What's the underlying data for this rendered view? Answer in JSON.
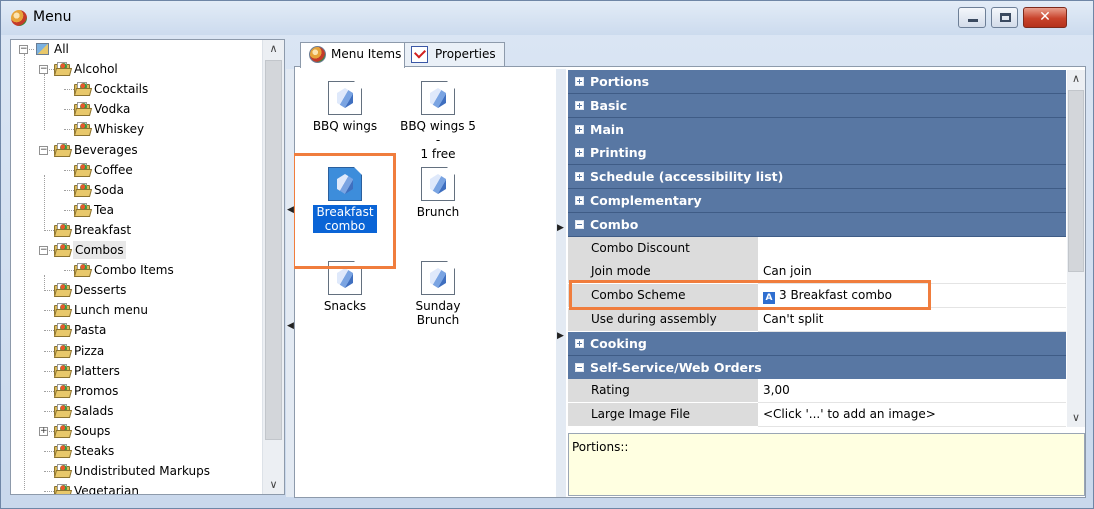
{
  "window": {
    "title": "Menu"
  },
  "tree": {
    "items": [
      {
        "label": "All",
        "level": 0,
        "expander": "minus",
        "icon": "all-icon"
      },
      {
        "label": "Alcohol",
        "level": 1,
        "expander": "minus",
        "icon": "folder-icon"
      },
      {
        "label": "Cocktails",
        "level": 2,
        "expander": "",
        "icon": "folder-icon"
      },
      {
        "label": "Vodka",
        "level": 2,
        "expander": "",
        "icon": "folder-icon"
      },
      {
        "label": "Whiskey",
        "level": 2,
        "expander": "",
        "icon": "folder-icon"
      },
      {
        "label": "Beverages",
        "level": 1,
        "expander": "minus",
        "icon": "folder-icon"
      },
      {
        "label": "Coffee",
        "level": 2,
        "expander": "",
        "icon": "folder-icon"
      },
      {
        "label": "Soda",
        "level": 2,
        "expander": "",
        "icon": "folder-icon"
      },
      {
        "label": "Tea",
        "level": 2,
        "expander": "",
        "icon": "folder-icon"
      },
      {
        "label": "Breakfast",
        "level": 1,
        "expander": "",
        "icon": "folder-icon"
      },
      {
        "label": "Combos",
        "level": 1,
        "expander": "minus",
        "icon": "folder-icon",
        "selected": true
      },
      {
        "label": "Combo Items",
        "level": 2,
        "expander": "",
        "icon": "folder-icon"
      },
      {
        "label": "Desserts",
        "level": 1,
        "expander": "",
        "icon": "folder-icon"
      },
      {
        "label": "Lunch menu",
        "level": 1,
        "expander": "",
        "icon": "folder-icon"
      },
      {
        "label": "Pasta",
        "level": 1,
        "expander": "",
        "icon": "folder-icon"
      },
      {
        "label": "Pizza",
        "level": 1,
        "expander": "",
        "icon": "folder-icon"
      },
      {
        "label": "Platters",
        "level": 1,
        "expander": "",
        "icon": "folder-icon"
      },
      {
        "label": "Promos",
        "level": 1,
        "expander": "",
        "icon": "folder-icon"
      },
      {
        "label": "Salads",
        "level": 1,
        "expander": "",
        "icon": "folder-icon"
      },
      {
        "label": "Soups",
        "level": 1,
        "expander": "plus",
        "icon": "folder-icon"
      },
      {
        "label": "Steaks",
        "level": 1,
        "expander": "",
        "icon": "folder-icon"
      },
      {
        "label": "Undistributed Markups",
        "level": 1,
        "expander": "",
        "icon": "folder-icon"
      },
      {
        "label": "Vegetarian",
        "level": 1,
        "expander": "",
        "icon": "folder-icon"
      }
    ]
  },
  "tabs": [
    {
      "label": "Menu Items",
      "active": true,
      "icon": "menu-items-icon"
    },
    {
      "label": "Properties",
      "active": false,
      "icon": "properties-icon"
    }
  ],
  "menu_items": [
    {
      "label_lines": [
        "BBQ wings"
      ],
      "selected": false
    },
    {
      "label_lines": [
        "BBQ wings 5 -",
        "1 free"
      ],
      "selected": false
    },
    {
      "label_lines": [
        "Breakfast",
        "combo"
      ],
      "selected": true
    },
    {
      "label_lines": [
        "Brunch"
      ],
      "selected": false
    },
    {
      "label_lines": [
        "Snacks"
      ],
      "selected": false
    },
    {
      "label_lines": [
        "Sunday",
        "Brunch"
      ],
      "selected": false
    }
  ],
  "property_grid": {
    "rows": [
      {
        "type": "category",
        "label": "Portions",
        "expanded": false
      },
      {
        "type": "category",
        "label": "Basic",
        "expanded": false
      },
      {
        "type": "category",
        "label": "Main",
        "expanded": false
      },
      {
        "type": "category",
        "label": "Printing",
        "expanded": false
      },
      {
        "type": "category",
        "label": "Schedule (accessibility list)",
        "expanded": false
      },
      {
        "type": "category",
        "label": "Complementary",
        "expanded": false
      },
      {
        "type": "category",
        "label": "Combo",
        "expanded": true
      },
      {
        "type": "property",
        "name": "Combo Discount",
        "value": ""
      },
      {
        "type": "property",
        "name": "Join mode",
        "value": "Can join"
      },
      {
        "type": "property",
        "name": "Combo Scheme",
        "value": "3 Breakfast combo",
        "value_icon": "A",
        "highlighted": true
      },
      {
        "type": "property",
        "name": "Use during assembly",
        "value": "Can't split"
      },
      {
        "type": "category",
        "label": "Cooking",
        "expanded": false
      },
      {
        "type": "category",
        "label": "Self-Service/Web Orders",
        "expanded": true
      },
      {
        "type": "property",
        "name": "Rating",
        "value": "3,00"
      },
      {
        "type": "property",
        "name": "Large Image File",
        "value": "<Click '...' to add an image>"
      }
    ]
  },
  "description": {
    "text": "Portions::"
  },
  "colors": {
    "category_bg": "#5877a3",
    "highlight": "#f07d3d",
    "selection": "#0a64d6",
    "description_bg": "#ffffe1"
  }
}
